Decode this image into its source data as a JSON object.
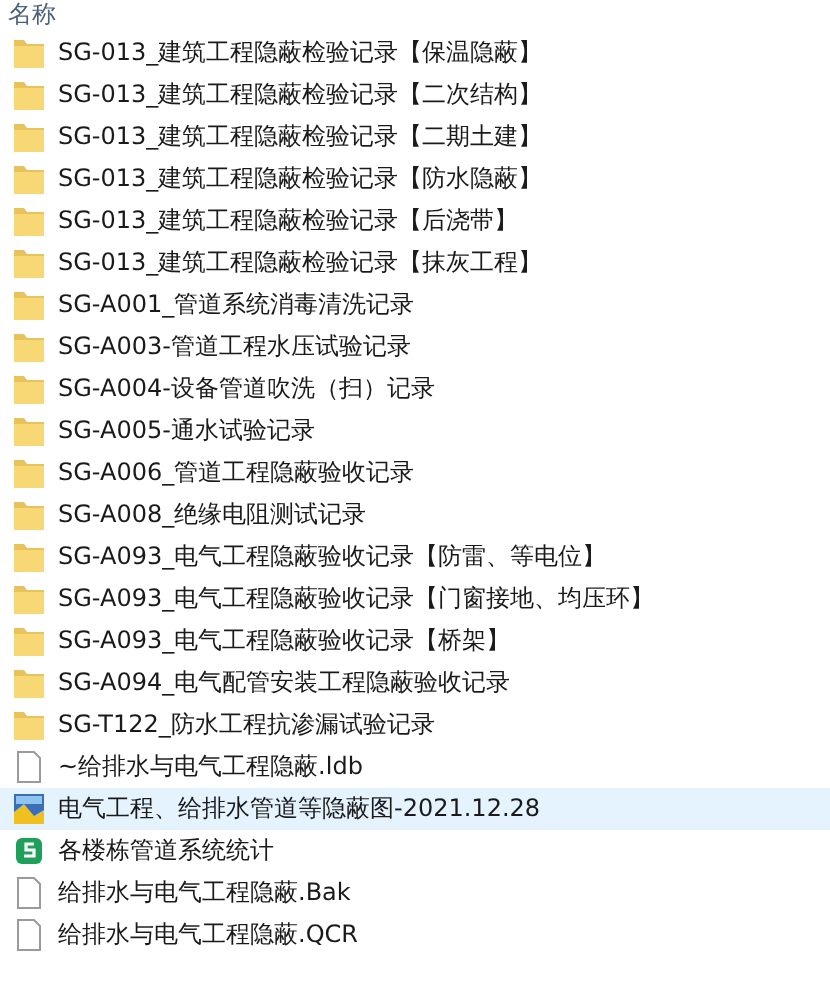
{
  "header": {
    "column_1": "名称"
  },
  "files": [
    {
      "name": "SG-013_建筑工程隐蔽检验记录【保温隐蔽】",
      "kind": "folder",
      "selected": false
    },
    {
      "name": "SG-013_建筑工程隐蔽检验记录【二次结构】",
      "kind": "folder",
      "selected": false
    },
    {
      "name": "SG-013_建筑工程隐蔽检验记录【二期土建】",
      "kind": "folder",
      "selected": false
    },
    {
      "name": "SG-013_建筑工程隐蔽检验记录【防水隐蔽】",
      "kind": "folder",
      "selected": false
    },
    {
      "name": "SG-013_建筑工程隐蔽检验记录【后浇带】",
      "kind": "folder",
      "selected": false
    },
    {
      "name": "SG-013_建筑工程隐蔽检验记录【抹灰工程】",
      "kind": "folder",
      "selected": false
    },
    {
      "name": "SG-A001_管道系统消毒清洗记录",
      "kind": "folder",
      "selected": false
    },
    {
      "name": "SG-A003-管道工程水压试验记录",
      "kind": "folder",
      "selected": false
    },
    {
      "name": "SG-A004-设备管道吹洗（扫）记录",
      "kind": "folder",
      "selected": false
    },
    {
      "name": "SG-A005-通水试验记录",
      "kind": "folder",
      "selected": false
    },
    {
      "name": "SG-A006_管道工程隐蔽验收记录",
      "kind": "folder",
      "selected": false
    },
    {
      "name": "SG-A008_绝缘电阻测试记录",
      "kind": "folder",
      "selected": false
    },
    {
      "name": "SG-A093_电气工程隐蔽验收记录【防雷、等电位】",
      "kind": "folder",
      "selected": false
    },
    {
      "name": "SG-A093_电气工程隐蔽验收记录【门窗接地、均压环】",
      "kind": "folder",
      "selected": false
    },
    {
      "name": "SG-A093_电气工程隐蔽验收记录【桥架】",
      "kind": "folder",
      "selected": false
    },
    {
      "name": "SG-A094_电气配管安装工程隐蔽验收记录",
      "kind": "folder",
      "selected": false
    },
    {
      "name": "SG-T122_防水工程抗渗漏试验记录",
      "kind": "folder",
      "selected": false
    },
    {
      "name": "~给排水与电气工程隐蔽.ldb",
      "kind": "file",
      "selected": false
    },
    {
      "name": "电气工程、给排水管道等隐蔽图-2021.12.28",
      "kind": "image",
      "selected": true
    },
    {
      "name": "各楼栋管道系统统计",
      "kind": "sheet",
      "selected": false
    },
    {
      "name": "给排水与电气工程隐蔽.Bak",
      "kind": "file",
      "selected": false
    },
    {
      "name": "给排水与电气工程隐蔽.QCR",
      "kind": "file",
      "selected": false
    }
  ]
}
